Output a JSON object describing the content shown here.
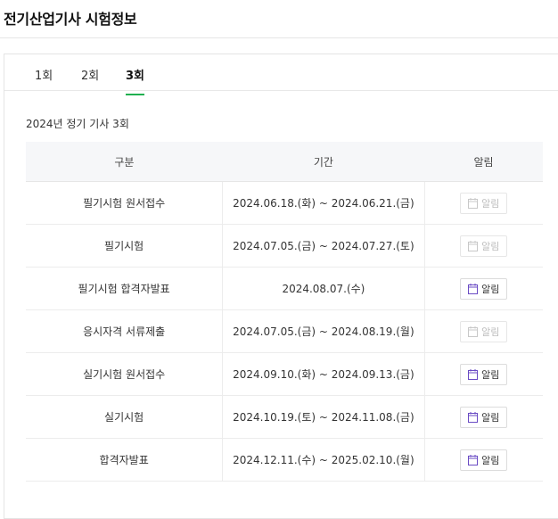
{
  "page": {
    "title": "전기산업기사 시험정보"
  },
  "tabs": [
    {
      "label": "1회",
      "active": false
    },
    {
      "label": "2회",
      "active": false
    },
    {
      "label": "3회",
      "active": true
    }
  ],
  "section": {
    "title": "2024년 정기 기사 3회"
  },
  "table": {
    "headers": {
      "gubun": "구분",
      "period": "기간",
      "alarm": "알림"
    },
    "rows": [
      {
        "gubun": "필기시험 원서접수",
        "period": "2024.06.18.(화) ~ 2024.06.21.(금)",
        "alarm": "알림",
        "alarm_enabled": false
      },
      {
        "gubun": "필기시험",
        "period": "2024.07.05.(금) ~ 2024.07.27.(토)",
        "alarm": "알림",
        "alarm_enabled": false
      },
      {
        "gubun": "필기시험 합격자발표",
        "period": "2024.08.07.(수)",
        "alarm": "알림",
        "alarm_enabled": true
      },
      {
        "gubun": "응시자격 서류제출",
        "period": "2024.07.05.(금) ~ 2024.08.19.(월)",
        "alarm": "알림",
        "alarm_enabled": false
      },
      {
        "gubun": "실기시험 원서접수",
        "period": "2024.09.10.(화) ~ 2024.09.13.(금)",
        "alarm": "알림",
        "alarm_enabled": true
      },
      {
        "gubun": "실기시험",
        "period": "2024.10.19.(토) ~ 2024.11.08.(금)",
        "alarm": "알림",
        "alarm_enabled": true
      },
      {
        "gubun": "합격자발표",
        "period": "2024.12.11.(수) ~ 2025.02.10.(월)",
        "alarm": "알림",
        "alarm_enabled": true
      }
    ]
  },
  "colors": {
    "accent": "#20b050",
    "calendar_icon": "#6a4bc4",
    "disabled": "#c8c8c8"
  },
  "icons": {
    "alarm": "calendar-icon"
  }
}
